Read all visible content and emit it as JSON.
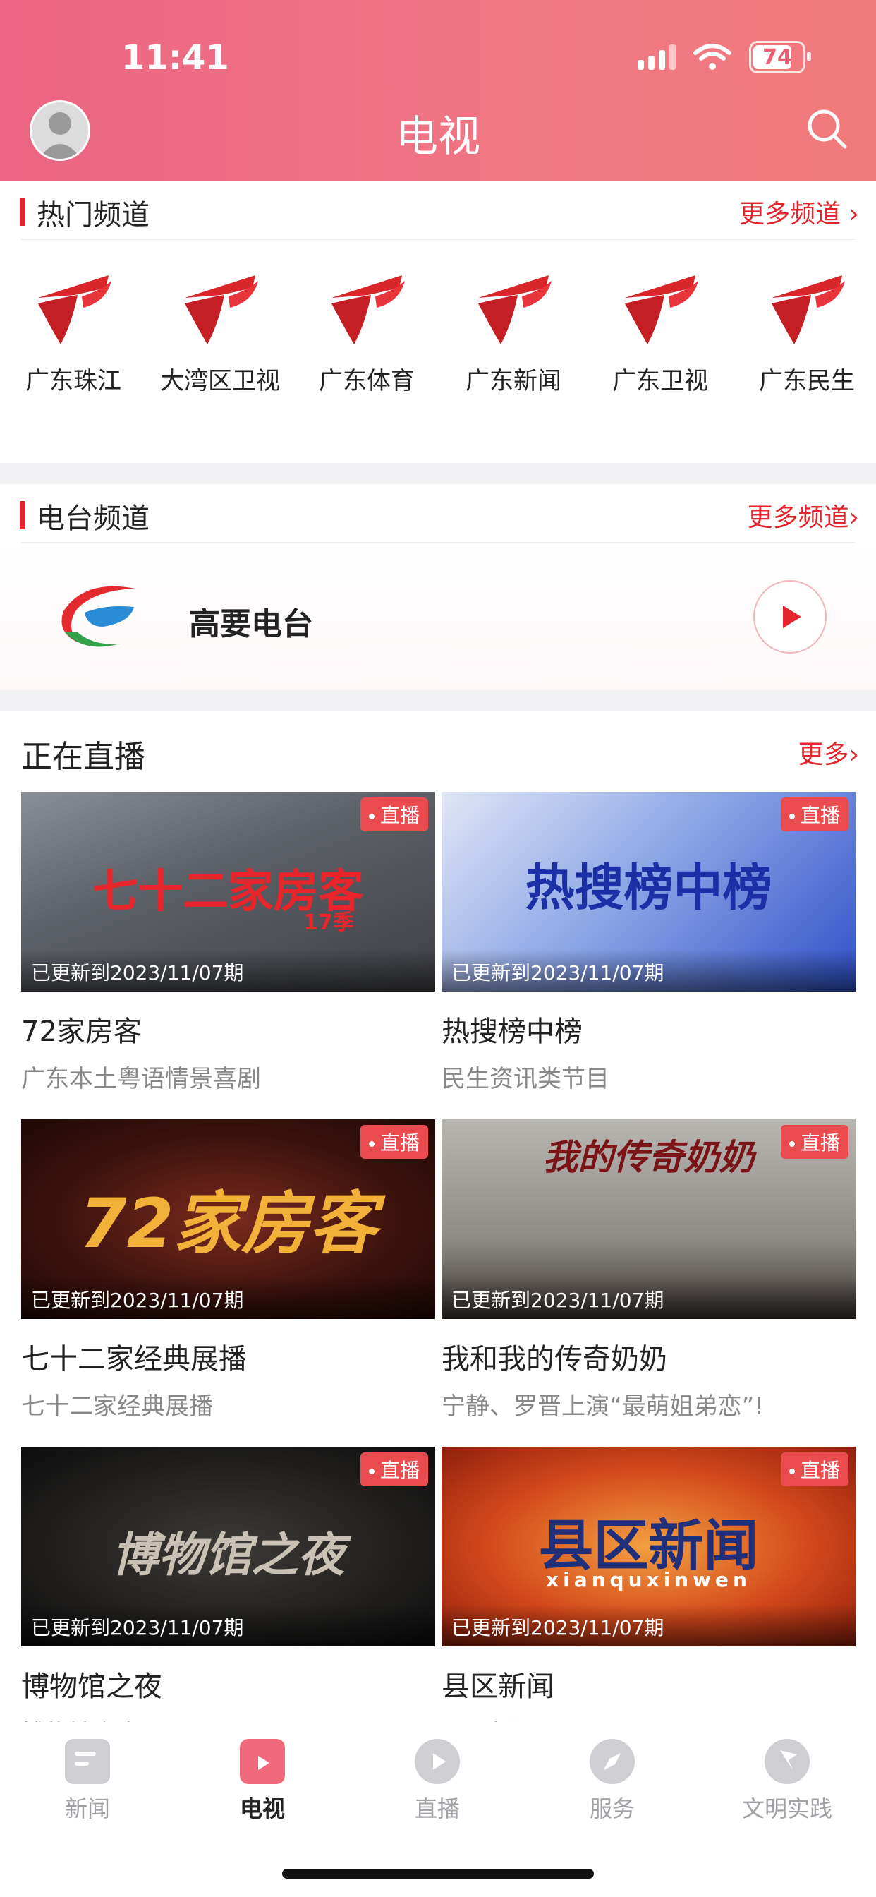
{
  "status": {
    "time": "11:41",
    "battery": "74"
  },
  "header": {
    "title": "电视"
  },
  "hot": {
    "title": "热门频道",
    "more": "更多频道",
    "channels": [
      {
        "name": "广东珠江"
      },
      {
        "name": "大湾区卫视"
      },
      {
        "name": "广东体育"
      },
      {
        "name": "广东新闻"
      },
      {
        "name": "广东卫视"
      },
      {
        "name": "广东民生"
      }
    ]
  },
  "radio": {
    "title": "电台频道",
    "more": "更多频道",
    "station": "高要电台"
  },
  "live": {
    "title": "正在直播",
    "more": "更多",
    "badge": "直播",
    "items": [
      {
        "title": "72家房客",
        "subtitle": "广东本土粤语情景喜剧",
        "updated": "已更新到2023/11/07期",
        "art": "七十二家房客",
        "art2": "17季"
      },
      {
        "title": "热搜榜中榜",
        "subtitle": "民生资讯类节目",
        "updated": "已更新到2023/11/07期",
        "art": "热搜榜中榜"
      },
      {
        "title": "七十二家经典展播",
        "subtitle": "七十二家经典展播",
        "updated": "已更新到2023/11/07期",
        "art": "72家房客"
      },
      {
        "title": "我和我的传奇奶奶",
        "subtitle": "宁静、罗晋上演“最萌姐弟恋”!",
        "updated": "已更新到2023/11/07期",
        "art": "我的传奇奶奶"
      },
      {
        "title": "博物馆之夜",
        "subtitle": "博物馆之夜",
        "updated": "已更新到2023/11/07期",
        "art": "博物馆之夜"
      },
      {
        "title": "县区新闻",
        "subtitle": "县区新闻",
        "updated": "已更新到2023/11/07期",
        "art": "县区新闻",
        "art2": "xianquxinwen"
      }
    ]
  },
  "tabs": [
    {
      "label": "新闻"
    },
    {
      "label": "电视"
    },
    {
      "label": "直播"
    },
    {
      "label": "服务"
    },
    {
      "label": "文明实践"
    }
  ]
}
